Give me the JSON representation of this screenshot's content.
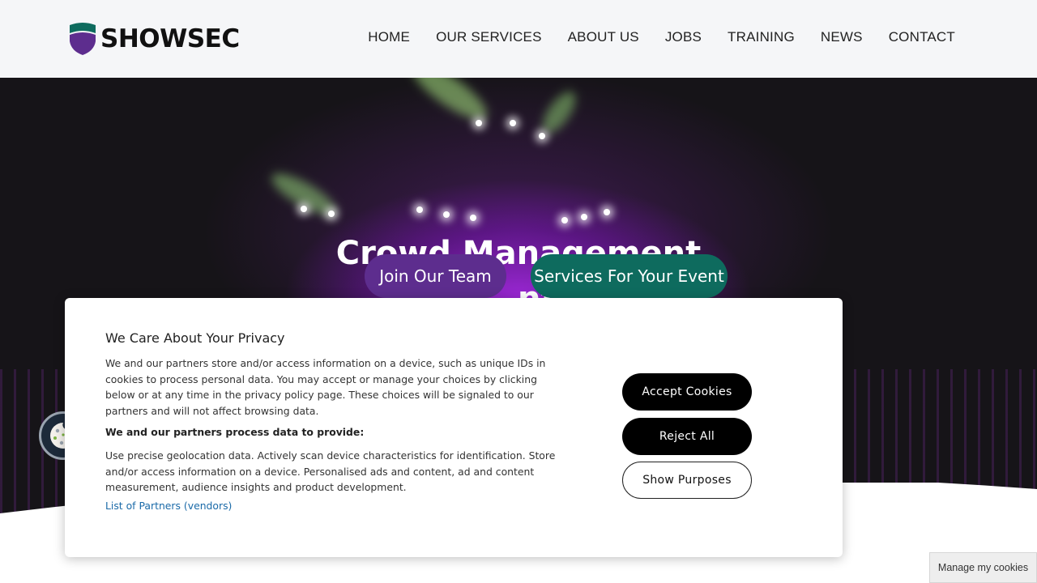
{
  "header": {
    "logo_text": "SHOWSEC",
    "nav": [
      "HOME",
      "OUR SERVICES",
      "ABOUT US",
      "JOBS",
      "TRAINING",
      "NEWS",
      "CONTACT"
    ]
  },
  "hero": {
    "title_line1": "Crowd Management",
    "title_line2": "...nt",
    "join_button": "Join Our Team",
    "services_button": "Services For Your Event"
  },
  "consent": {
    "title": "We Care About Your Privacy",
    "intro": "We and our partners store and/or access information on a device, such as unique IDs in cookies to process personal data. You may accept or manage your choices by clicking below or at any time in the privacy policy page. These choices will be signaled to our partners and will not affect browsing data.",
    "process_heading": "We and our partners process data to provide:",
    "process_text": "Use precise geolocation data. Actively scan device characteristics for identification. Store and/or access information on a device. Personalised ads and content, ad and content measurement, audience insights and product development.",
    "partners_link": "List of Partners (vendors)",
    "accept_button": "Accept Cookies",
    "reject_button": "Reject All",
    "purposes_button": "Show Purposes"
  },
  "manage_cookies": "Manage my cookies",
  "colors": {
    "brand_teal": "#0e6b5e",
    "brand_purple": "#5d2d8e",
    "link": "#1a6aa8"
  }
}
